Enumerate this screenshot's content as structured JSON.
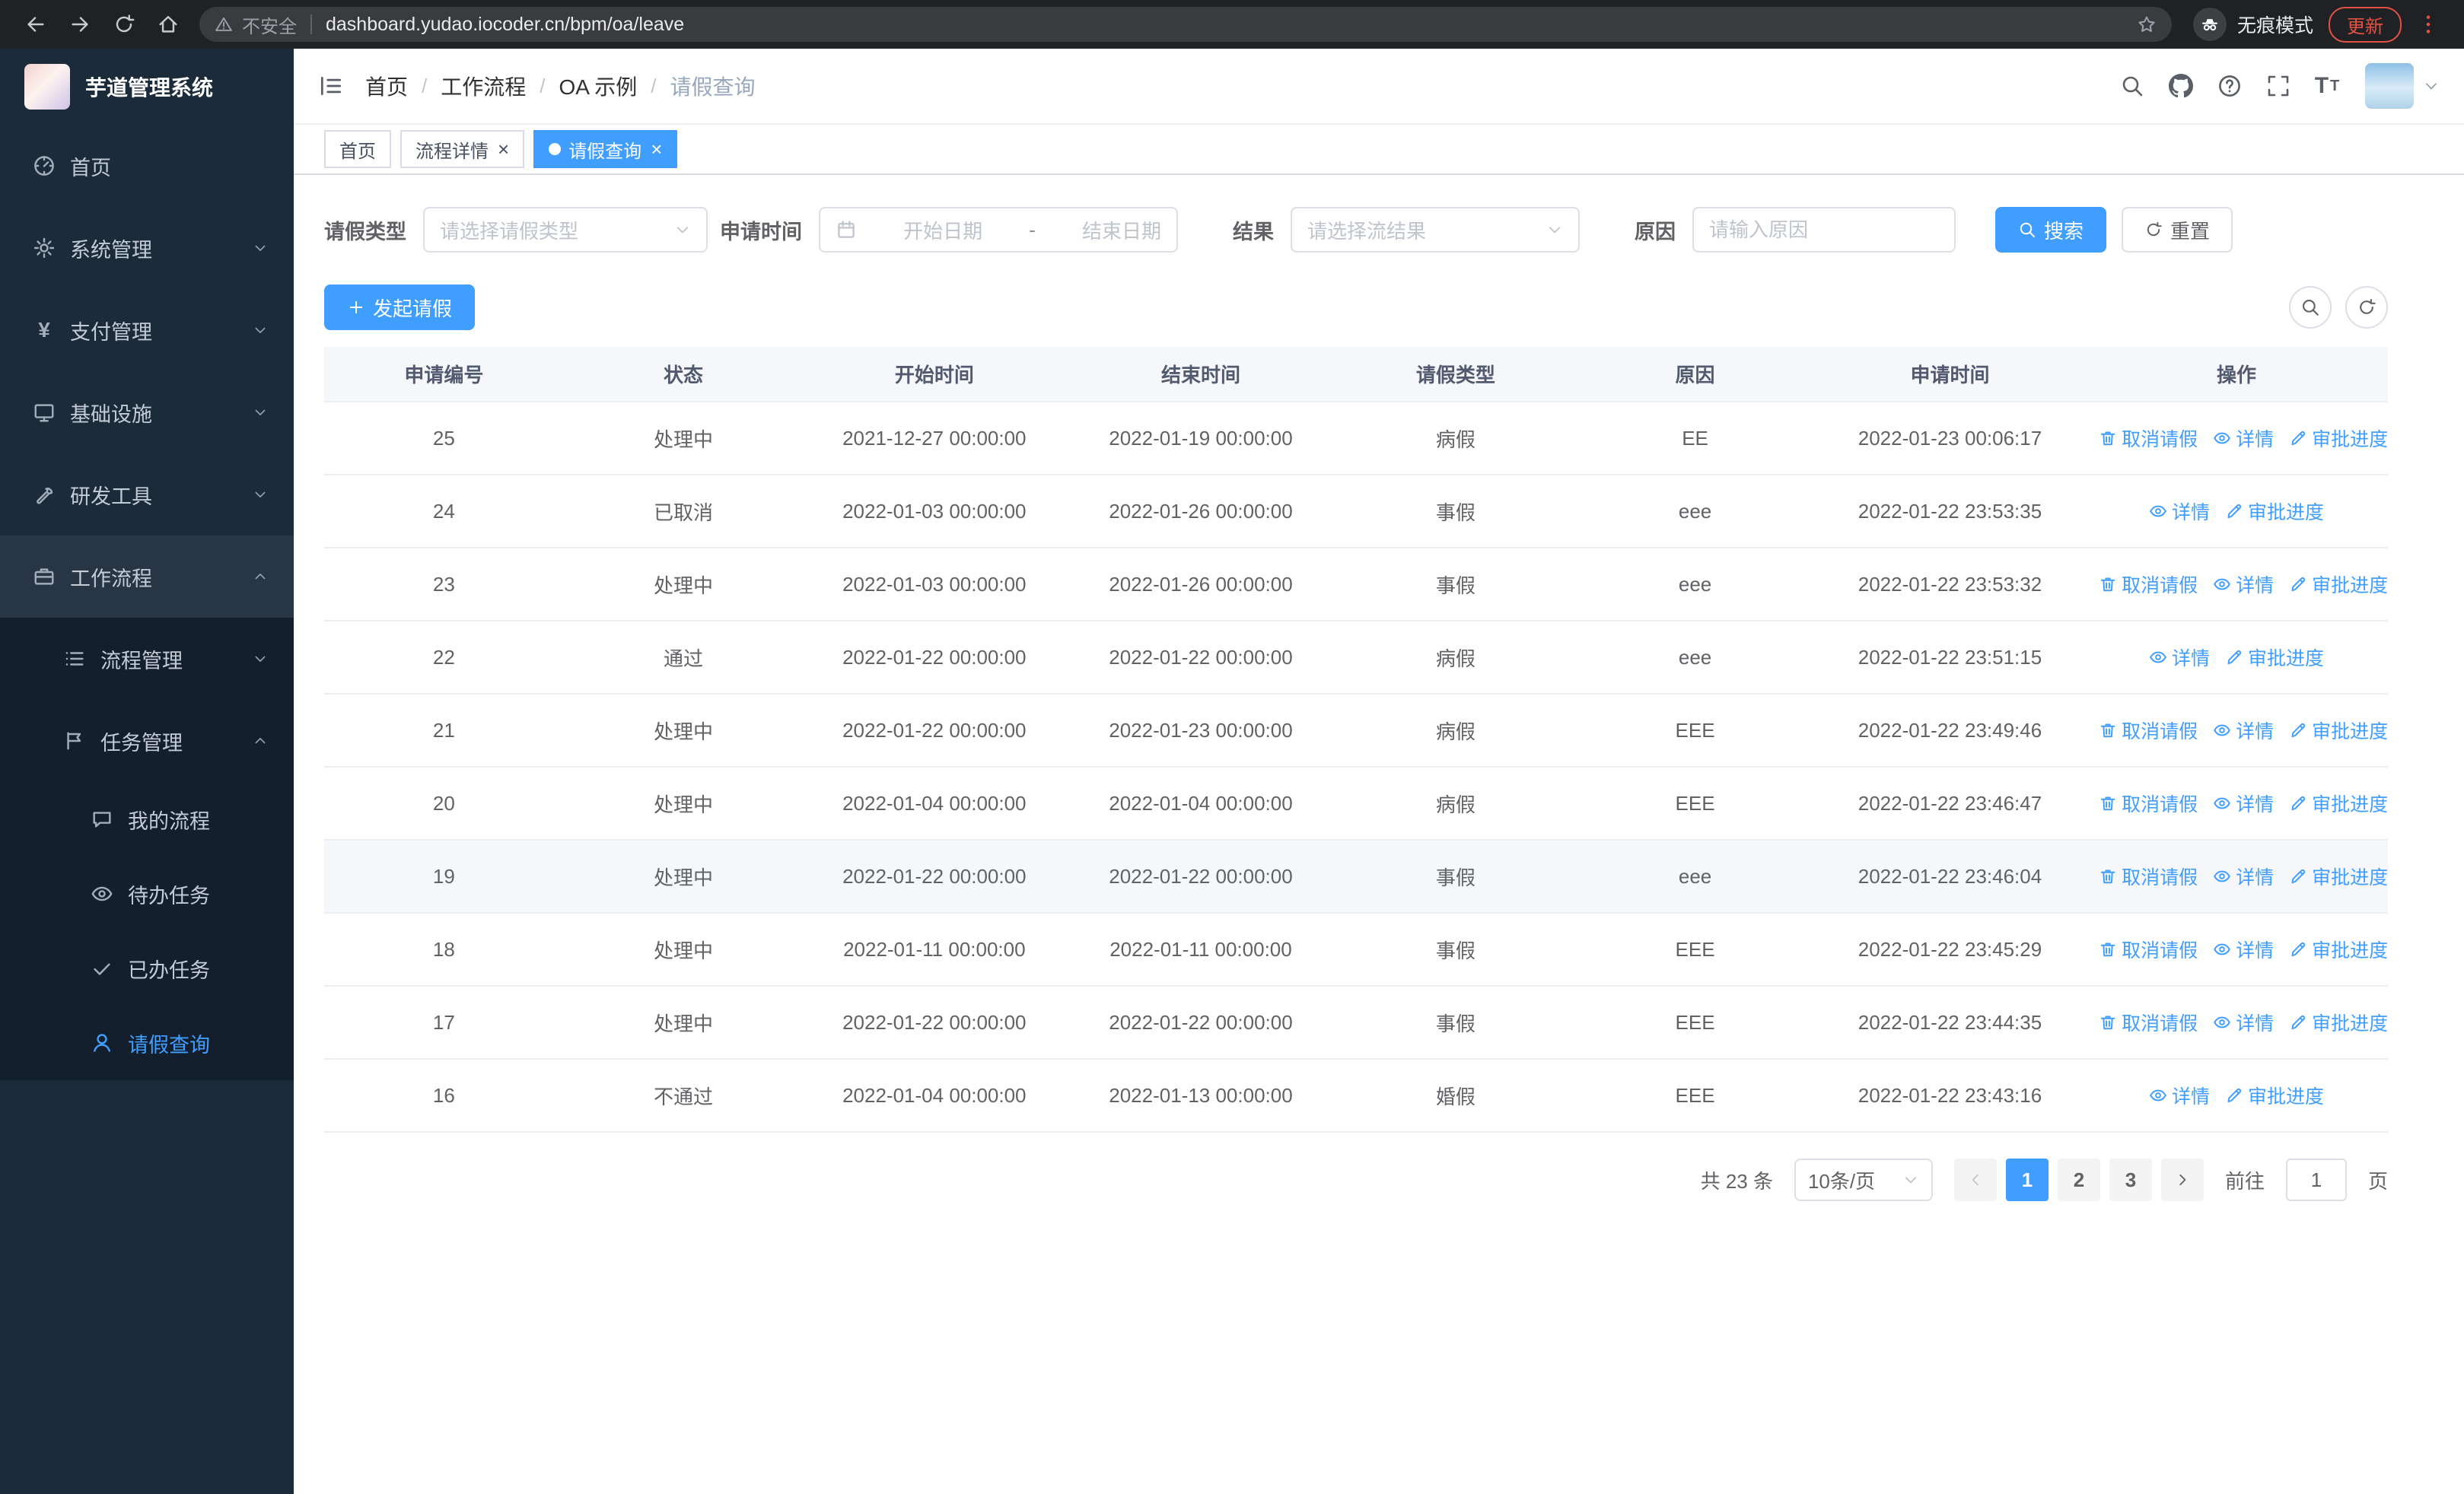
{
  "browser": {
    "security_label": "不安全",
    "url": "dashboard.yudao.iocoder.cn/bpm/oa/leave",
    "incognito_label": "无痕模式",
    "update_label": "更新"
  },
  "colors": {
    "accent": "#409eff",
    "sidebar_bg": "#1c2b3a",
    "sidebar_submenu_bg": "#131f2d",
    "update_red": "#e25142",
    "table_header_bg": "#f5f7fa"
  },
  "app": {
    "logo_title": "芋道管理系统",
    "sidebar": {
      "menu": [
        {
          "name": "home",
          "label": "首页",
          "icon": "dashboard-icon"
        },
        {
          "name": "system-management",
          "label": "系统管理",
          "icon": "gear-icon",
          "chevron": "down"
        },
        {
          "name": "payment-management",
          "label": "支付管理",
          "icon": "payment-icon",
          "chevron": "down"
        },
        {
          "name": "infrastructure",
          "label": "基础设施",
          "icon": "monitor-icon",
          "chevron": "down"
        },
        {
          "name": "dev-tools",
          "label": "研发工具",
          "icon": "tools-icon",
          "chevron": "down"
        },
        {
          "name": "workflow",
          "label": "工作流程",
          "icon": "briefcase-icon",
          "chevron": "up",
          "expanded": true,
          "children": [
            {
              "name": "process-management",
              "label": "流程管理",
              "icon": "list-icon",
              "chevron": "down"
            },
            {
              "name": "task-management",
              "label": "任务管理",
              "icon": "flag-icon",
              "chevron": "up",
              "expanded": true,
              "children": [
                {
                  "name": "my-process",
                  "label": "我的流程",
                  "icon": "chat-icon"
                },
                {
                  "name": "todo-tasks",
                  "label": "待办任务",
                  "icon": "eye-icon"
                },
                {
                  "name": "done-tasks",
                  "label": "已办任务",
                  "icon": "check-icon"
                },
                {
                  "name": "leave-query",
                  "label": "请假查询",
                  "icon": "user-icon",
                  "active": true
                }
              ]
            }
          ]
        }
      ]
    },
    "breadcrumb": [
      "首页",
      "工作流程",
      "OA 示例",
      "请假查询"
    ],
    "tabs": [
      {
        "name": "home",
        "label": "首页",
        "closable": false,
        "active": false
      },
      {
        "name": "process-detail",
        "label": "流程详情",
        "closable": true,
        "active": false
      },
      {
        "name": "leave-query",
        "label": "请假查询",
        "closable": true,
        "active": true
      }
    ],
    "filters": {
      "leave_type_label": "请假类型",
      "leave_type_placeholder": "请选择请假类型",
      "apply_time_label": "申请时间",
      "date_start_placeholder": "开始日期",
      "date_separator": "-",
      "date_end_placeholder": "结束日期",
      "result_label": "结果",
      "result_placeholder": "请选择流结果",
      "reason_label": "原因",
      "reason_placeholder": "请输入原因",
      "search_label": "搜索",
      "reset_label": "重置"
    },
    "toolbar": {
      "create_label": "发起请假"
    },
    "table": {
      "columns": [
        "申请编号",
        "状态",
        "开始时间",
        "结束时间",
        "请假类型",
        "原因",
        "申请时间",
        "操作"
      ],
      "action_labels": {
        "cancel": "取消请假",
        "detail": "详情",
        "progress": "审批进度"
      },
      "action_icons": {
        "cancel": "delete-icon",
        "detail": "eye-icon",
        "progress": "edit-icon"
      },
      "rows": [
        {
          "id": "25",
          "status": "处理中",
          "start": "2021-12-27 00:00:00",
          "end": "2022-01-19 00:00:00",
          "type": "病假",
          "reason": "EE",
          "applied": "2022-01-23 00:06:17",
          "actions": [
            "cancel",
            "detail",
            "progress"
          ]
        },
        {
          "id": "24",
          "status": "已取消",
          "start": "2022-01-03 00:00:00",
          "end": "2022-01-26 00:00:00",
          "type": "事假",
          "reason": "eee",
          "applied": "2022-01-22 23:53:35",
          "actions": [
            "detail",
            "progress"
          ]
        },
        {
          "id": "23",
          "status": "处理中",
          "start": "2022-01-03 00:00:00",
          "end": "2022-01-26 00:00:00",
          "type": "事假",
          "reason": "eee",
          "applied": "2022-01-22 23:53:32",
          "actions": [
            "cancel",
            "detail",
            "progress"
          ]
        },
        {
          "id": "22",
          "status": "通过",
          "start": "2022-01-22 00:00:00",
          "end": "2022-01-22 00:00:00",
          "type": "病假",
          "reason": "eee",
          "applied": "2022-01-22 23:51:15",
          "actions": [
            "detail",
            "progress"
          ]
        },
        {
          "id": "21",
          "status": "处理中",
          "start": "2022-01-22 00:00:00",
          "end": "2022-01-23 00:00:00",
          "type": "病假",
          "reason": "EEE",
          "applied": "2022-01-22 23:49:46",
          "actions": [
            "cancel",
            "detail",
            "progress"
          ]
        },
        {
          "id": "20",
          "status": "处理中",
          "start": "2022-01-04 00:00:00",
          "end": "2022-01-04 00:00:00",
          "type": "病假",
          "reason": "EEE",
          "applied": "2022-01-22 23:46:47",
          "actions": [
            "cancel",
            "detail",
            "progress"
          ]
        },
        {
          "id": "19",
          "status": "处理中",
          "start": "2022-01-22 00:00:00",
          "end": "2022-01-22 00:00:00",
          "type": "事假",
          "reason": "eee",
          "applied": "2022-01-22 23:46:04",
          "actions": [
            "cancel",
            "detail",
            "progress"
          ],
          "highlight": true
        },
        {
          "id": "18",
          "status": "处理中",
          "start": "2022-01-11 00:00:00",
          "end": "2022-01-11 00:00:00",
          "type": "事假",
          "reason": "EEE",
          "applied": "2022-01-22 23:45:29",
          "actions": [
            "cancel",
            "detail",
            "progress"
          ]
        },
        {
          "id": "17",
          "status": "处理中",
          "start": "2022-01-22 00:00:00",
          "end": "2022-01-22 00:00:00",
          "type": "事假",
          "reason": "EEE",
          "applied": "2022-01-22 23:44:35",
          "actions": [
            "cancel",
            "detail",
            "progress"
          ]
        },
        {
          "id": "16",
          "status": "不通过",
          "start": "2022-01-04 00:00:00",
          "end": "2022-01-13 00:00:00",
          "type": "婚假",
          "reason": "EEE",
          "applied": "2022-01-22 23:43:16",
          "actions": [
            "detail",
            "progress"
          ]
        }
      ]
    },
    "pagination": {
      "total_label": "共 23 条",
      "page_size_label": "10条/页",
      "pages": [
        "1",
        "2",
        "3"
      ],
      "active_page": "1",
      "goto_label": "前往",
      "goto_value": "1",
      "page_unit": "页"
    }
  }
}
